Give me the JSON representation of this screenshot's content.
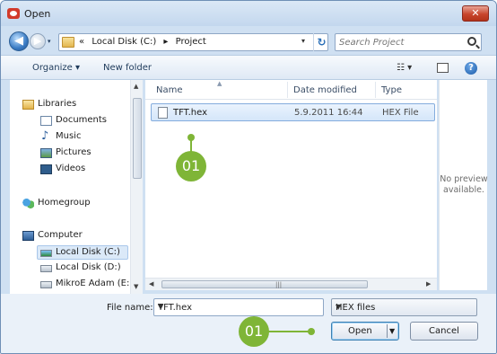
{
  "window": {
    "title": "Open",
    "close_label": "✕"
  },
  "address": {
    "crumbs": [
      "«",
      "Local Disk (C:)",
      "▸",
      "Project"
    ],
    "search_placeholder": "Search Project"
  },
  "toolbar": {
    "organize": "Organize ▾",
    "new_folder": "New folder",
    "view_label": "☷ ▾",
    "help_label": "?"
  },
  "nav": {
    "items": [
      {
        "label": "Libraries"
      },
      {
        "label": "Documents"
      },
      {
        "label": "Music"
      },
      {
        "label": "Pictures"
      },
      {
        "label": "Videos"
      },
      {
        "label": "Homegroup"
      },
      {
        "label": "Computer"
      },
      {
        "label": "Local Disk (C:)"
      },
      {
        "label": "Local Disk (D:)"
      },
      {
        "label": "MikroE Adam (E:"
      }
    ]
  },
  "columns": {
    "name": "Name",
    "date": "Date modified",
    "type": "Type"
  },
  "files": [
    {
      "name": "TFT.hex",
      "date": "5.9.2011 16:44",
      "type": "HEX File"
    }
  ],
  "preview": {
    "text": "No preview available."
  },
  "footer": {
    "file_name_label": "File name:",
    "file_name_value": "TFT.hex",
    "filter_value": "HEX files",
    "open_label": "Open",
    "cancel_label": "Cancel"
  },
  "annotations": {
    "marker1": "01",
    "marker2": "01",
    "color": "#7fb537"
  },
  "colors": {
    "accent": "#7fb537",
    "selection": "#d4e6fa",
    "close": "#c8452c"
  }
}
